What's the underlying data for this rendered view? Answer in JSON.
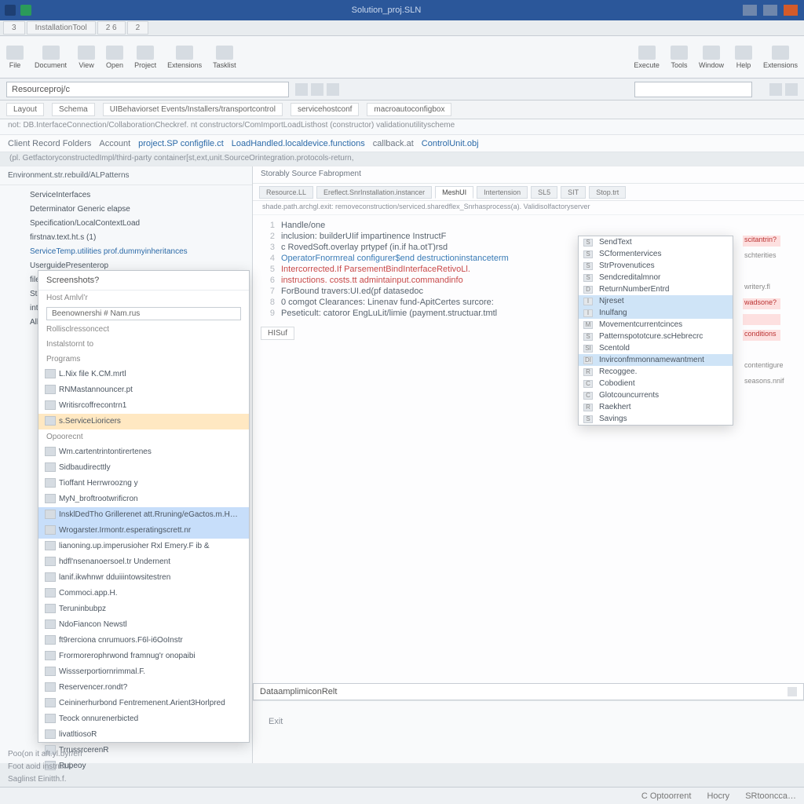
{
  "title": "Solution_proj.SLN",
  "quick_tabs": [
    "3",
    "InstallationTool",
    "2 6",
    "2"
  ],
  "ribbon": [
    {
      "label": "File"
    },
    {
      "label": "Document"
    },
    {
      "label": "View"
    },
    {
      "label": "Open"
    },
    {
      "label": "Project"
    },
    {
      "label": "Extensions"
    },
    {
      "label": "Tasklist"
    },
    {
      "label": "Execute"
    },
    {
      "label": "Tools"
    },
    {
      "label": "Window"
    },
    {
      "label": "Help"
    },
    {
      "label": "Extensions"
    }
  ],
  "address": "Resourceproj/c",
  "toolbar2": [
    "Layout",
    "Schema",
    "UIBehaviorset Events/Installers/transportcontrol",
    "servicehostconf",
    "macroautoconfigbox"
  ],
  "infobar": "not: DB.InterfaceConnection/CollaborationCheckref. nt constructors/ComImportLoadListhost (constructor) validationutilityscheme",
  "crumbs_main": [
    "Client Record Folders",
    "Account",
    "project.SP configfile.ct",
    "LoadHandled.localdevice.functions",
    "callback.at",
    "ControlUnit.obj"
  ],
  "crumbs_sub": "(pl. GetfactoryconstructedImpl/third-party container[st,ext,unit.SourceOrintegration.protocols-return,",
  "left_tree_head": "Environment.str.rebuild/ALPatterns",
  "left_tree": [
    "ServiceInterfaces",
    "Determinator Generic elapse",
    "Specification/LocalContextLoad",
    "firstnav.text.ht.s    (1)",
    "ServiceTemp.utilities  prof.dummyinheritances",
    "UserguidePresenterop",
    "fileout.std. C text/parsers",
    "Statementspan",
    "int :announceret-Operations",
    "All undisturbed fields"
  ],
  "editor_head": "Storably Source Fabropment",
  "editor_tabs": [
    {
      "label": "Resource.LL",
      "active": false
    },
    {
      "label": "Ereflect.SnrInstallation.instancer",
      "active": false
    },
    {
      "label": "MeshUI",
      "active": true
    },
    {
      "label": "Intertension",
      "active": false
    },
    {
      "label": "SL5",
      "active": false
    },
    {
      "label": "SIT",
      "active": false
    },
    {
      "label": "Stop.trt",
      "active": false
    }
  ],
  "crumb2": "shade.path.archgl.exit:  removeconstruction/serviced.sharedflex_Snrhasprocess(a).  Validisolfactoryserver",
  "code": [
    {
      "n": 1,
      "t": "Handle/one",
      "c": "k"
    },
    {
      "n": 2,
      "t": "inclusion: builderUIif impartinence  InstructF",
      "c": "k"
    },
    {
      "n": 3,
      "t": "c RovedSoft.overlay prtypef  (in.if  ha.otT)rsd",
      "c": "k"
    },
    {
      "n": 4,
      "t": "OperatorFnormreal  configurer$end destructioninstanceterm",
      "c": "bl"
    },
    {
      "n": 5,
      "t": "Intercorrected.If ParsementBindInterfaceRetivoLl.",
      "c": "r"
    },
    {
      "n": 6,
      "t": "instructions. costs.tt admintainput.commandinfo",
      "c": "r"
    },
    {
      "n": 7,
      "t": "ForBound travers:UI.ed(pf datasedoc",
      "c": "k"
    },
    {
      "n": 8,
      "t": "0 comgot Clearances: Linenav fund-ApitCertes  surcore:",
      "c": "k"
    },
    {
      "n": 9,
      "t": "Peseticult: catoror EngLuLit/limie (payment.structuar.tmtl",
      "c": "k"
    }
  ],
  "code_btn": "HISuf",
  "popup": [
    {
      "ic": "S",
      "t": "SendText"
    },
    {
      "ic": "S",
      "t": "SCformentervices"
    },
    {
      "ic": "S",
      "t": "StrProvenutices"
    },
    {
      "ic": "S",
      "t": "Sendcreditalmnor"
    },
    {
      "ic": "D",
      "t": "ReturnNumberEntrd"
    },
    {
      "ic": "I",
      "t": "Njreset",
      "sel": true
    },
    {
      "ic": "I",
      "t": "Inulfang",
      "sel": true
    },
    {
      "ic": "M",
      "t": "Movementcurrentcinces"
    },
    {
      "ic": "S",
      "t": "Patternspototcure.scHebrecrc"
    },
    {
      "ic": "SI",
      "t": "Scentold"
    },
    {
      "ic": "DI",
      "t": "Invirconfmmonnamewantment",
      "sel": true
    },
    {
      "ic": "R",
      "t": "Recoggee."
    },
    {
      "ic": "C",
      "t": "Cobodient"
    },
    {
      "ic": "C",
      "t": "Glotcouncurrents"
    },
    {
      "ic": "R",
      "t": "Raekhert"
    },
    {
      "ic": "S",
      "t": "Savings"
    }
  ],
  "right_chips": [
    {
      "t": "scitantrin?",
      "c": "err"
    },
    {
      "t": "schterities",
      "c": "ok"
    },
    {
      "t": "",
      "c": "ok"
    },
    {
      "t": "writery.fl",
      "c": "ok"
    },
    {
      "t": "wadsone?",
      "c": "err"
    },
    {
      "t": "",
      "c": "err"
    },
    {
      "t": "conditions",
      "c": "err"
    },
    {
      "t": "",
      "c": "ok"
    },
    {
      "t": "contentigure",
      "c": "ok"
    },
    {
      "t": "seasons.nnif",
      "c": "ok"
    }
  ],
  "output_label": "DataamplimiconRelt",
  "output_body": "Exit",
  "panel_left": {
    "title": "Screenshots?",
    "sec1": "Host Amlvl’r",
    "field1": "Beenownershi  # Nam.rus",
    "field2": "Rollisclressoncect",
    "field3": "Instalstornt   to",
    "sec2": "Programs",
    "items_a": [
      "L.Nix file K.CM.mrtl",
      "RNMastannouncer.pt",
      "Writisrcoffrecontrn1",
      "s.ServiceLioricers"
    ],
    "sec_open": "Opoorecnt",
    "items_b": [
      "Wm.cartentrintontirertenes",
      "Sidbaudirecttly",
      "Tioffant Herrwroozng y",
      "MyN_broftrootwrificron",
      "InsklDedTho Grillerenet att.Rruning/eGactos.m.Hemunber lat",
      "Wrogarster.Irmontr.esperatingscrett.nr",
      "lianoning.up.imperusioher Rxl Emery.F ib &",
      "hdfl'nsenanoersoel.tr Undernent",
      "lanif.ikwhnwr dduiiintowsitestren",
      "Commoci.app.H.",
      "Teruninbubpz",
      "NdoFiancon Newstl",
      "ft9rerciona cnrumuors.F6l-i6OoInstr",
      "Frormorerophrwond framnug'r onopaibi",
      "Wissserportiornrimmal.F.",
      "Reservencer.rondt?",
      "Ceininerhurbond Fentremenent.Arient3Horlpred",
      "Teock onnurenerbicted",
      "livatltiosoR",
      "TrrussrcerenR",
      "Rupeoy"
    ],
    "hl_indices": [
      4,
      5
    ],
    "hl2_index": 3
  },
  "footer": [
    "Poo(on it aft.yl.byr/err",
    "Foot aoid instruit.f.",
    "Saglinst Einitth.f."
  ],
  "status": {
    "left": "",
    "center": "C Optoorrent",
    "right": "Hocry",
    "far": "SRtooncca…"
  }
}
